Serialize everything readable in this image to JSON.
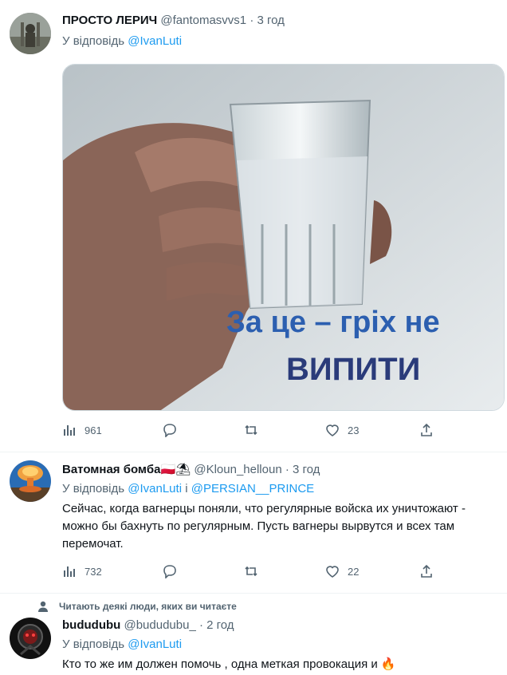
{
  "tweets": [
    {
      "name": "ПРОСТО ЛЕРИЧ",
      "handle": "@fantomasvvs1",
      "dot": "·",
      "time": "3 год",
      "reply_prefix": "У відповідь",
      "reply_to": "@IvanLuti",
      "reply_join": "",
      "reply_to2": "",
      "image_text_line1": "За це – гріх не",
      "image_text_line2": "ВИПИТИ",
      "views": "961",
      "replies": "",
      "retweets": "",
      "likes": "23"
    },
    {
      "name": "Ватомная бомба",
      "name_emoji": "🇵🇱⛱",
      "handle": "@Kloun_helloun",
      "dot": "·",
      "time": "3 год",
      "reply_prefix": "У відповідь",
      "reply_to": "@IvanLuti",
      "reply_join": "і",
      "reply_to2": "@PERSIAN__PRINCE",
      "text": "Сейчас, когда вагнерцы поняли, что регулярные войска их уничтожают - можно бы бахнуть по регулярным. Пусть вагнеры вырвутся и всех там перемочат.",
      "views": "732",
      "likes": "22"
    },
    {
      "social_context": "Читають деякі люди, яких ви читаєте",
      "name": "bududubu",
      "handle": "@bududubu_",
      "dot": "·",
      "time": "2 год",
      "reply_prefix": "У відповідь",
      "reply_to": "@IvanLuti",
      "text": "Кто то же им должен помочь , одна меткая провокация и 🔥"
    }
  ],
  "colors": {
    "link": "#1d9bf0",
    "secondary": "#536471",
    "text": "#0f1419",
    "divider": "#eff3f4"
  }
}
